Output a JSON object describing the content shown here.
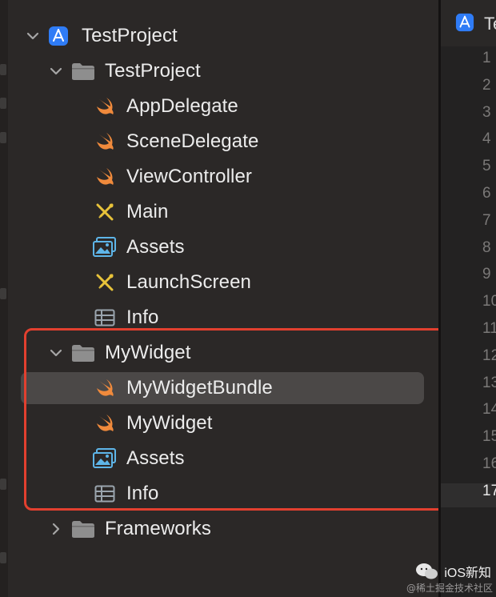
{
  "project": {
    "name": "TestProject"
  },
  "groups": [
    {
      "name": "TestProject",
      "files": [
        {
          "name": "AppDelegate",
          "icon": "swift-file-icon"
        },
        {
          "name": "SceneDelegate",
          "icon": "swift-file-icon"
        },
        {
          "name": "ViewController",
          "icon": "swift-file-icon"
        },
        {
          "name": "Main",
          "icon": "storyboard-icon"
        },
        {
          "name": "Assets",
          "icon": "asset-catalog-icon"
        },
        {
          "name": "LaunchScreen",
          "icon": "storyboard-icon"
        },
        {
          "name": "Info",
          "icon": "plist-icon"
        }
      ]
    },
    {
      "name": "MyWidget",
      "files": [
        {
          "name": "MyWidgetBundle",
          "icon": "swift-file-icon",
          "selected": true
        },
        {
          "name": "MyWidget",
          "icon": "swift-file-icon"
        },
        {
          "name": "Assets",
          "icon": "asset-catalog-icon"
        },
        {
          "name": "Info",
          "icon": "plist-icon"
        }
      ]
    },
    {
      "name": "Frameworks",
      "collapsed": true
    }
  ],
  "editor": {
    "tab_label": "Te",
    "line_numbers": [
      "1",
      "2",
      "3",
      "4",
      "5",
      "6",
      "7",
      "8",
      "9",
      "10",
      "11",
      "12",
      "13",
      "14",
      "15",
      "16",
      "17"
    ],
    "current_line": "17"
  },
  "watermark": {
    "title": "iOS新知",
    "sub": "@稀土掘金技术社区"
  },
  "colors": {
    "highlight": "#e2402f",
    "swift": "#f08a3c",
    "folder": "#8e8e8e",
    "app_icon": "#2f7cf6"
  }
}
